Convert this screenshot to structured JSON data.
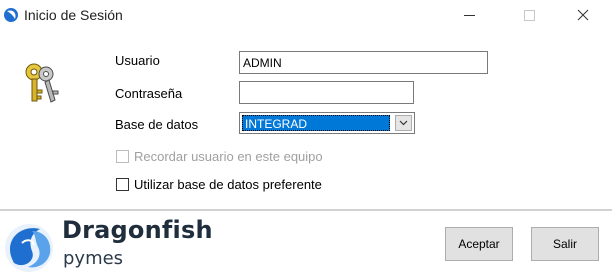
{
  "window": {
    "title": "Inicio de Sesión",
    "icons": {
      "app": "dragonfish-app-icon",
      "minimize": "minimize-icon",
      "maximize": "maximize-icon",
      "close": "close-icon"
    }
  },
  "form": {
    "user_label": "Usuario",
    "user_value": "ADMIN",
    "password_label": "Contraseña",
    "password_value": "",
    "database_label": "Base de datos",
    "database_value": "INTEGRAD",
    "remember_label": "Recordar usuario en este equipo",
    "remember_checked": false,
    "remember_enabled": false,
    "preferred_label": "Utilizar base de datos preferente",
    "preferred_checked": false
  },
  "brand": {
    "name": "Dragonfish",
    "sub": "pymes",
    "colors": {
      "primary": "#1f6fd1",
      "dark": "#1f2d3d",
      "selection": "#0078d7"
    }
  },
  "buttons": {
    "accept": "Aceptar",
    "exit": "Salir"
  },
  "icons": {
    "keys": "keys-icon",
    "dropdown": "chevron-down-icon"
  }
}
